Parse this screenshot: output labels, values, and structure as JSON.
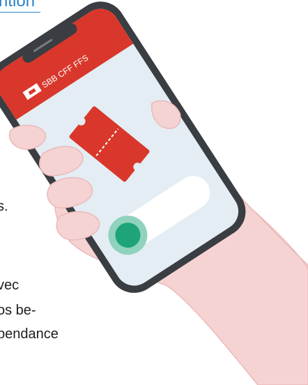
{
  "header_link": {
    "label": "ntion"
  },
  "body": {
    "lines": [
      "s.",
      "vec",
      "os be-",
      "pendance"
    ]
  },
  "phone": {
    "brand": "SBB CFF FFS",
    "header_color": "#d9372b",
    "screen_color": "#e3edf3",
    "action_color": "#1ea37a"
  },
  "icons": {
    "logo": "sbb-logo-icon",
    "ticket": "ticket-icon",
    "action": "green-circle-button"
  }
}
